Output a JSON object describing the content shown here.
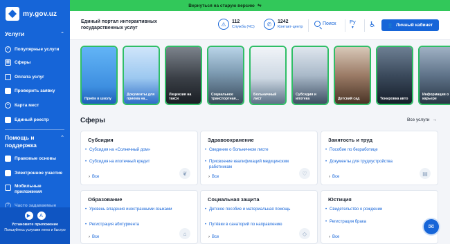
{
  "banner": {
    "text": "Вернуться на старую версию",
    "icon": "swap-icon"
  },
  "logo": {
    "text": "my.gov.uz"
  },
  "sidebar": {
    "services_title": "Услуги",
    "services": [
      {
        "label": "Популярные услуги",
        "icon": "check-circle-icon"
      },
      {
        "label": "Сферы",
        "icon": "grid-icon"
      },
      {
        "label": "Оплата услуг",
        "icon": "card-icon"
      },
      {
        "label": "Проверить заявку",
        "icon": "document-icon"
      },
      {
        "label": "Карта мест",
        "icon": "location-icon"
      },
      {
        "label": "Единый реестр",
        "icon": "registry-icon"
      }
    ],
    "help_title": "Помощь и поддержка",
    "help": [
      {
        "label": "Правовые основы",
        "icon": "book-icon"
      },
      {
        "label": "Электронное участие",
        "icon": "participation-icon"
      },
      {
        "label": "Мобильные приложения",
        "icon": "phone-icon"
      },
      {
        "label": "Часто задаваемые",
        "icon": "question-icon"
      }
    ],
    "install": {
      "title": "Установите приложение",
      "subtitle": "Пользуйтесь услугами легко и быстро"
    }
  },
  "header": {
    "title": "Единый портал интерактивных государственных услуг",
    "emergency": {
      "number": "112",
      "label": "Служба (ЧС)"
    },
    "contact": {
      "number": "1242",
      "label": "Контакт-центр"
    },
    "search_label": "Поиск",
    "language": "Ру",
    "cabinet_label": "Личный кабинет"
  },
  "stories": [
    {
      "caption": "Приём в школу",
      "color": "#4ea3ee"
    },
    {
      "caption": "Документы для приема на...",
      "color": "#8bc0f0"
    },
    {
      "caption": "Лицензия на такси",
      "color": "#444a52"
    },
    {
      "caption": "Социальное транспортная...",
      "color": "#6c8fa6"
    },
    {
      "caption": "Больничный лист",
      "color": "#c8d4e0"
    },
    {
      "caption": "Субсидия и ипотека",
      "color": "#93a7bd"
    },
    {
      "caption": "Детский сад",
      "color": "#8b6b58"
    },
    {
      "caption": "Тонировка авто",
      "color": "#2d3c4e"
    },
    {
      "caption": "Информация о карьере",
      "color": "#5a6e86"
    }
  ],
  "spheres": {
    "title": "Сферы",
    "all_label": "Все услуги",
    "more_label": "Все",
    "cards": [
      {
        "title": "Субсидия",
        "items": [
          "Субсидия на «Солнечный дом»",
          "Субсидия на ипотечный кредит"
        ],
        "icon": "leaf-icon"
      },
      {
        "title": "Здравоохранение",
        "items": [
          "Сведение о больничном листе",
          "Присвоение квалификаций медицинским работникам"
        ],
        "icon": "stethoscope-icon"
      },
      {
        "title": "Занятость и труд",
        "items": [
          "Пособие по безработице",
          "Документы для трудоустройства"
        ],
        "icon": "briefcase-icon"
      },
      {
        "title": "Образование",
        "items": [
          "Уровень владения иностранными языками",
          "Регистрация абитуриента"
        ],
        "icon": "graduation-icon"
      },
      {
        "title": "Социальная защита",
        "items": [
          "Детское пособие и материальная помощь",
          "Путёвки в санаторий по направлению"
        ],
        "icon": "shield-icon"
      },
      {
        "title": "Юстиция",
        "items": [
          "Свидетельство о рождении",
          "Регистрация брака"
        ],
        "icon": "scales-icon"
      }
    ]
  },
  "chat": {
    "icon": "chat-icon"
  }
}
